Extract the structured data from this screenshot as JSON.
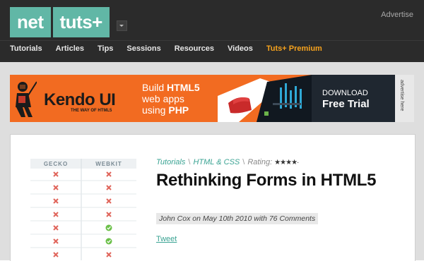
{
  "header": {
    "logo_left": "net",
    "logo_right": "tuts+",
    "advertise_label": "Advertise",
    "nav": [
      {
        "label": "Tutorials"
      },
      {
        "label": "Articles"
      },
      {
        "label": "Tips"
      },
      {
        "label": "Sessions"
      },
      {
        "label": "Resources"
      },
      {
        "label": "Videos"
      },
      {
        "label": "Tuts+ Premium",
        "color": "#f6a21d"
      }
    ]
  },
  "ad": {
    "brand": "Kendo UI",
    "tagline": "THE WAY OF HTML5",
    "build_line1": "Build",
    "build_html5": "HTML5",
    "build_line2": "web apps",
    "build_line3": "using",
    "build_php": "PHP",
    "download_line1": "DOWNLOAD",
    "download_line2": "Free Trial",
    "side_label": "advertise here",
    "colors": {
      "orange": "#f26b21",
      "dark": "#1f2730"
    }
  },
  "article": {
    "breadcrumb_1": "Tutorials",
    "breadcrumb_sep": "\\",
    "breadcrumb_2": "HTML & CSS",
    "rating_label": "Rating:",
    "rating_value": 3.5,
    "rating_max": 5,
    "title": "Rethinking Forms in HTML5",
    "byline": "John Cox on May 10th 2010 with 76 Comments",
    "tweet_label": "Tweet",
    "thumbnail": {
      "col1": "GECKO",
      "col2": "WEBKIT",
      "rows": [
        [
          "x",
          "x"
        ],
        [
          "x",
          "x"
        ],
        [
          "x",
          "x"
        ],
        [
          "x",
          "x"
        ],
        [
          "x",
          "check"
        ],
        [
          "x",
          "check"
        ],
        [
          "x",
          "x"
        ]
      ]
    },
    "accent_color": "#3aa393"
  }
}
